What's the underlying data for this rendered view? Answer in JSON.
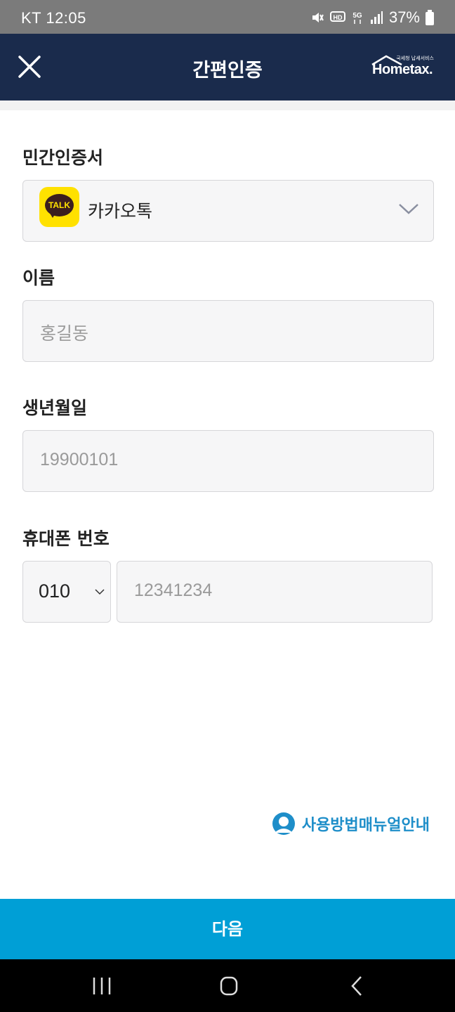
{
  "status_bar": {
    "carrier_time": "KT 12:05",
    "battery": "37%",
    "icons": [
      "mute-icon",
      "hd-icon",
      "5g-icon",
      "signal-icon",
      "battery-icon"
    ]
  },
  "header": {
    "title": "간편인증",
    "close_icon": "close-icon",
    "logo_text": "Hometax.",
    "logo_subtext": "국세청 납세서비스"
  },
  "cert": {
    "label": "민간인증서",
    "selected": "카카오톡",
    "icon_text": "TALK"
  },
  "name": {
    "label": "이름",
    "placeholder": "홍길동"
  },
  "birth": {
    "label": "생년월일",
    "placeholder": "19900101"
  },
  "phone": {
    "label": "휴대폰 번호",
    "prefix": "010",
    "placeholder": "12341234"
  },
  "manual_link": {
    "text": "사용방법매뉴얼안내"
  },
  "next_button": {
    "label": "다음"
  },
  "colors": {
    "header_bg": "#1a2b4c",
    "accent": "#009fd6",
    "link": "#1e8ec9",
    "kakao_yellow": "#ffe100"
  }
}
